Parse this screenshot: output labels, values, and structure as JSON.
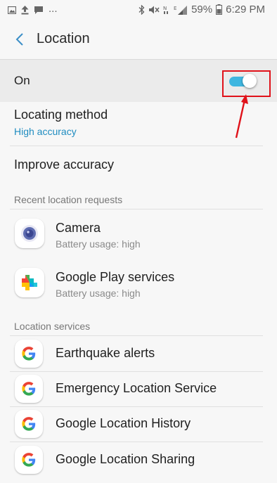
{
  "status_bar": {
    "left_more": "...",
    "battery_percent": "59%",
    "time": "6:29 PM"
  },
  "header": {
    "title": "Location"
  },
  "master_switch": {
    "label": "On",
    "state": "on",
    "accent_color": "#3fb6e0"
  },
  "settings": {
    "locating_method": {
      "label": "Locating method",
      "value": "High accuracy"
    },
    "improve_accuracy": {
      "label": "Improve accuracy"
    }
  },
  "recent_requests": {
    "header": "Recent location requests",
    "items": [
      {
        "name": "Camera",
        "detail": "Battery usage: high",
        "icon": "camera-icon"
      },
      {
        "name": "Google Play services",
        "detail": "Battery usage: high",
        "icon": "google-play-services-icon"
      }
    ]
  },
  "location_services": {
    "header": "Location services",
    "items": [
      {
        "name": "Earthquake alerts",
        "icon": "google-g-icon"
      },
      {
        "name": "Emergency Location Service",
        "icon": "google-g-icon"
      },
      {
        "name": "Google Location History",
        "icon": "google-g-icon"
      },
      {
        "name": "Google Location Sharing",
        "icon": "google-g-icon"
      }
    ]
  },
  "annotation": {
    "color": "#e0121a"
  }
}
